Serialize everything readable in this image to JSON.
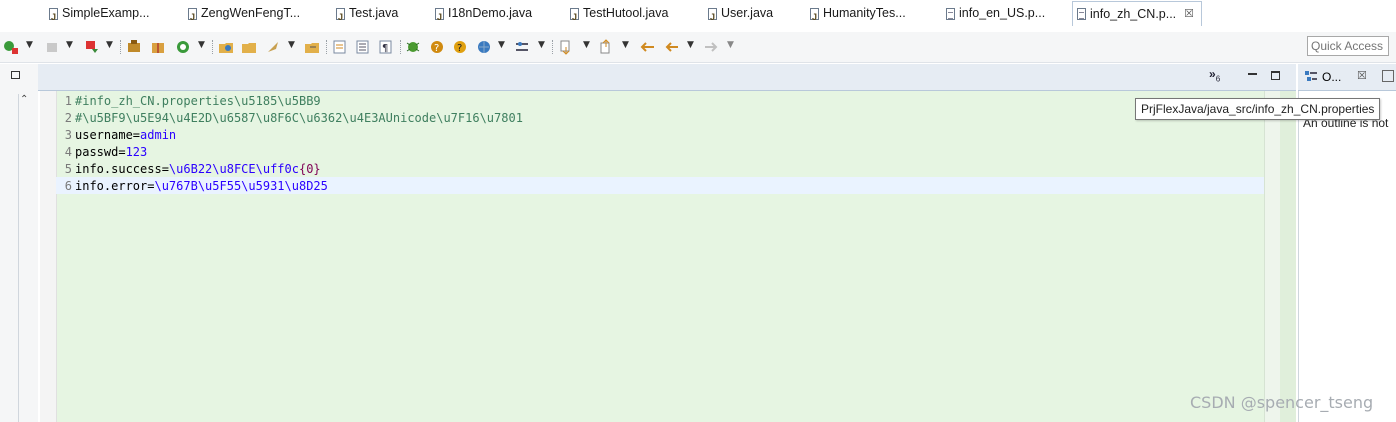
{
  "toolbar": {
    "quick_access_placeholder": "Quick Access"
  },
  "editor_tabs": [
    {
      "label": "SimpleExamp...",
      "type": "java"
    },
    {
      "label": "ZengWenFengT...",
      "type": "java"
    },
    {
      "label": "Test.java",
      "type": "java"
    },
    {
      "label": "I18nDemo.java",
      "type": "java"
    },
    {
      "label": "TestHutool.java",
      "type": "java"
    },
    {
      "label": "User.java",
      "type": "java"
    },
    {
      "label": "HumanityTes...",
      "type": "java"
    },
    {
      "label": "info_en_US.p...",
      "type": "props"
    },
    {
      "label": "info_zh_CN.p...",
      "type": "props",
      "active": true
    }
  ],
  "overflow_tabs": {
    "count": "6"
  },
  "tooltip": "PrjFlexJava/java_src/info_zh_CN.properties",
  "outline": {
    "tab_label": "O...",
    "message": "An outline is not"
  },
  "editor": {
    "lines": [
      {
        "num": "1",
        "comment": "#info_zh_CN.properties\\u5185\\u5BB9"
      },
      {
        "num": "2",
        "comment": "#\\u5BF9\\u5E94\\u4E2D\\u6587\\u8F6C\\u6362\\u4E3AUnicode\\u7F16\\u7801"
      },
      {
        "num": "3",
        "key": "username=",
        "value": "admin"
      },
      {
        "num": "4",
        "key": "passwd=",
        "value": "123"
      },
      {
        "num": "5",
        "key": "info.success=",
        "value": "\\u6B22\\u8FCE\\uff0c",
        "brace": "{0}"
      },
      {
        "num": "6",
        "key": "info.error=",
        "value": "\\u767B\\u5F55\\u5931\\u8D25"
      }
    ]
  },
  "watermark": "CSDN @spencer_tseng",
  "colors": {
    "editor_bg": "#e6f5e2",
    "comment": "#3f7f5f",
    "value": "#2a00ff",
    "brace": "#7f0055",
    "current_line": "#eaf3ff"
  }
}
